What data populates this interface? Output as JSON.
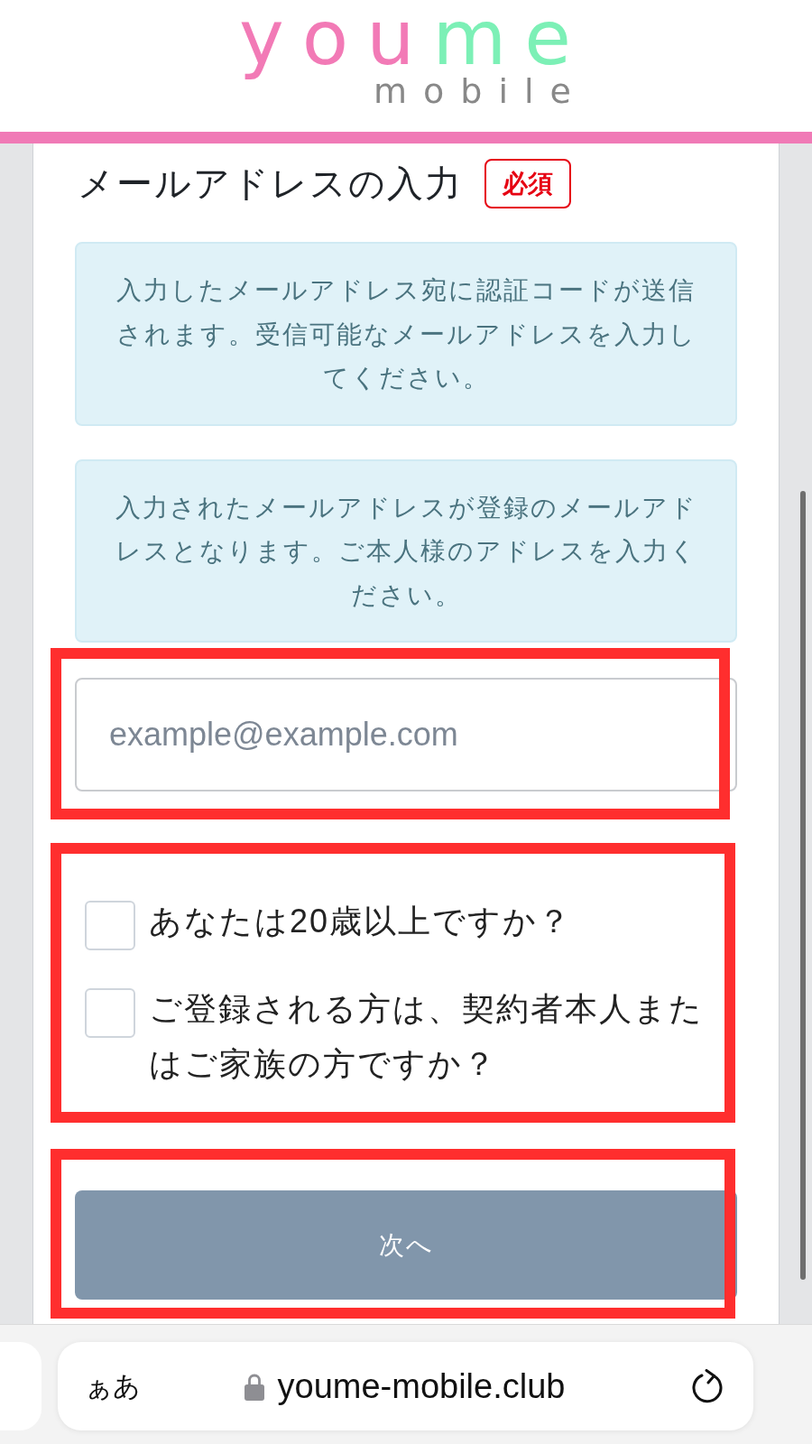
{
  "logo": {
    "parts": [
      {
        "text": "you",
        "color": "#f27ab6"
      },
      {
        "text": "me",
        "color": "#7cf0b6"
      }
    ],
    "subtitle": "mobile"
  },
  "form": {
    "title": "メールアドレスの入力",
    "required_badge": "必須",
    "notices": [
      "入力したメールアドレス宛に認証コードが送信されます。受信可能なメールアドレスを入力してください。",
      "入力されたメールアドレスが登録のメールアドレスとなります。ご本人様のアドレスを入力ください。"
    ],
    "email_field": {
      "placeholder": "example@example.com",
      "highlighted": true
    },
    "questions": {
      "highlighted": true,
      "items": [
        {
          "label": "あなたは20歳以上ですか？",
          "checked": false
        },
        {
          "label": "ご登録される方は、契約者本人またはご家族の方ですか？",
          "checked": false
        }
      ]
    },
    "next_button": {
      "label": "次へ",
      "disabled": true,
      "highlighted": true
    }
  },
  "browser_bar": {
    "text_size_button": "ぁあ",
    "secure": true,
    "url": "youme-mobile.club"
  }
}
